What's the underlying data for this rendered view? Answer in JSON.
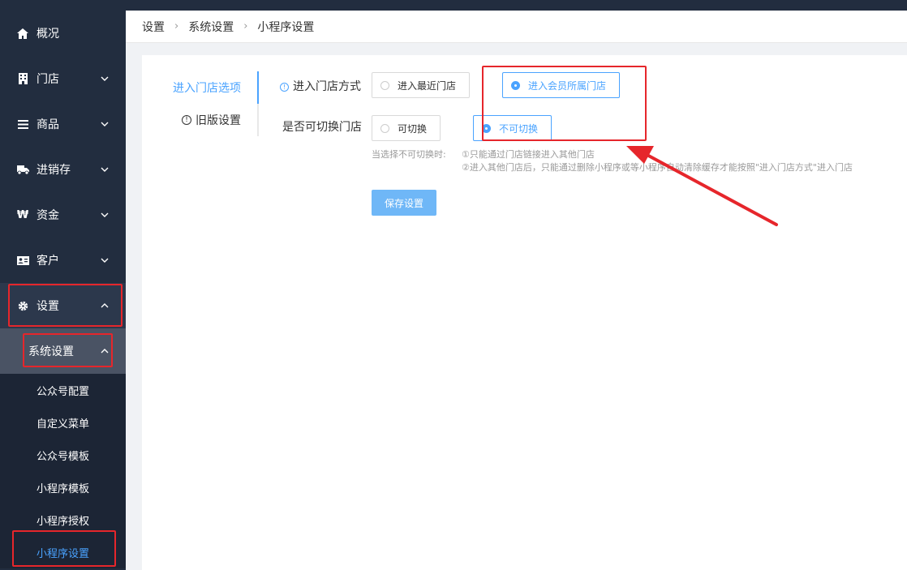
{
  "sidebar": {
    "items": [
      {
        "label": "概况",
        "icon": "home-icon"
      },
      {
        "label": "门店",
        "icon": "store-icon"
      },
      {
        "label": "商品",
        "icon": "list-icon"
      },
      {
        "label": "进销存",
        "icon": "truck-icon"
      },
      {
        "label": "资金",
        "icon": "won-icon"
      },
      {
        "label": "客户",
        "icon": "id-card-icon"
      },
      {
        "label": "设置",
        "icon": "gear-icon"
      }
    ],
    "submenu": {
      "label": "系统设置",
      "items": [
        "公众号配置",
        "自定义菜单",
        "公众号模板",
        "小程序模板",
        "小程序授权",
        "小程序设置"
      ]
    }
  },
  "breadcrumb": [
    "设置",
    "系统设置",
    "小程序设置"
  ],
  "tabs": [
    "进入门店选项",
    "旧版设置"
  ],
  "form": {
    "enter_store_label": "进入门店方式",
    "enter_options": [
      "进入最近门店",
      "进入会员所属门店"
    ],
    "switch_label": "是否可切换门店",
    "switch_options": [
      "可切换",
      "不可切换"
    ],
    "hint_prefix": "当选择不可切换时:",
    "hint_lines": [
      "①只能通过门店链接进入其他门店",
      "②进入其他门店后，只能通过删除小程序或等小程序自动清除缓存才能按照\"进入门店方式\"进入门店"
    ],
    "save_label": "保存设置"
  },
  "colors": {
    "sidebar_bg": "#222d3f",
    "accent": "#4aa3ff",
    "highlight": "#e6262b"
  }
}
